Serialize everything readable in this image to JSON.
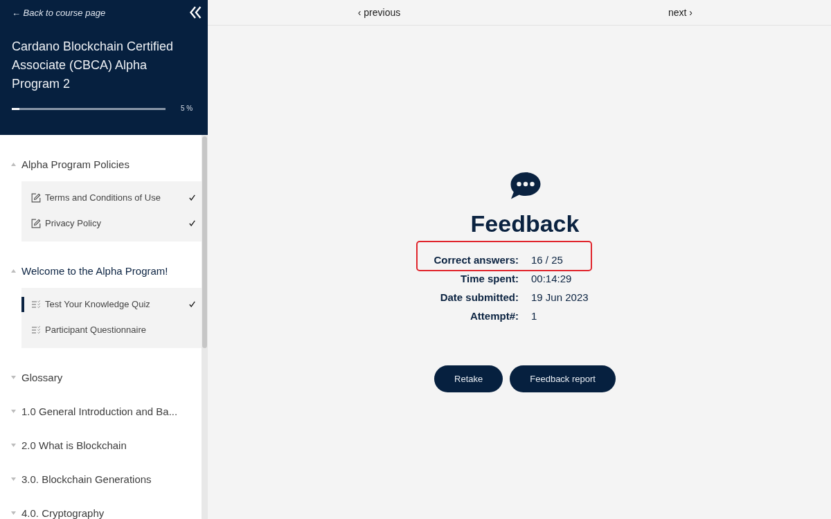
{
  "sidebar": {
    "back_link": "← Back to course page",
    "course_title": "Cardano Blockchain Certified Associate (CBCA) Alpha Program 2",
    "progress": {
      "level": 0.05,
      "reading": "5 %"
    },
    "sections": [
      {
        "title": "Alpha Program Policies",
        "expanded": true,
        "active": false,
        "children": [
          {
            "label": "Terms and Conditions of Use",
            "kind": "page",
            "completed": true,
            "selected": false
          },
          {
            "label": "Privacy Policy",
            "kind": "page",
            "completed": true,
            "selected": false
          }
        ]
      },
      {
        "title": "Welcome to the Alpha Program!",
        "expanded": true,
        "active": true,
        "children": [
          {
            "label": "Test Your Knowledge Quiz",
            "kind": "quiz",
            "completed": true,
            "selected": true
          },
          {
            "label": "Participant Questionnaire",
            "kind": "quiz",
            "completed": false,
            "selected": false
          }
        ]
      },
      {
        "title": "Glossary",
        "expanded": false,
        "active": false
      },
      {
        "title": "1.0 General Introduction and Ba...",
        "expanded": false,
        "active": false
      },
      {
        "title": "2.0 What is Blockchain",
        "expanded": false,
        "active": false
      },
      {
        "title": "3.0. Blockchain Generations",
        "expanded": false,
        "active": false
      },
      {
        "title": "4.0. Cryptography",
        "expanded": false,
        "active": false
      }
    ]
  },
  "nav": {
    "previous": "‹ previous",
    "next": "next ›"
  },
  "feedback": {
    "title": "Feedback",
    "rows": [
      {
        "label": "Correct answers:",
        "value": "16 / 25",
        "highlighted": true
      },
      {
        "label": "Time spent:",
        "value": "00:14:29",
        "highlighted": false
      },
      {
        "label": "Date submitted:",
        "value": "19 Jun 2023",
        "highlighted": false
      },
      {
        "label": "Attempt#:",
        "value": "1",
        "highlighted": false
      }
    ],
    "buttons": [
      "Retake",
      "Feedback report"
    ]
  }
}
